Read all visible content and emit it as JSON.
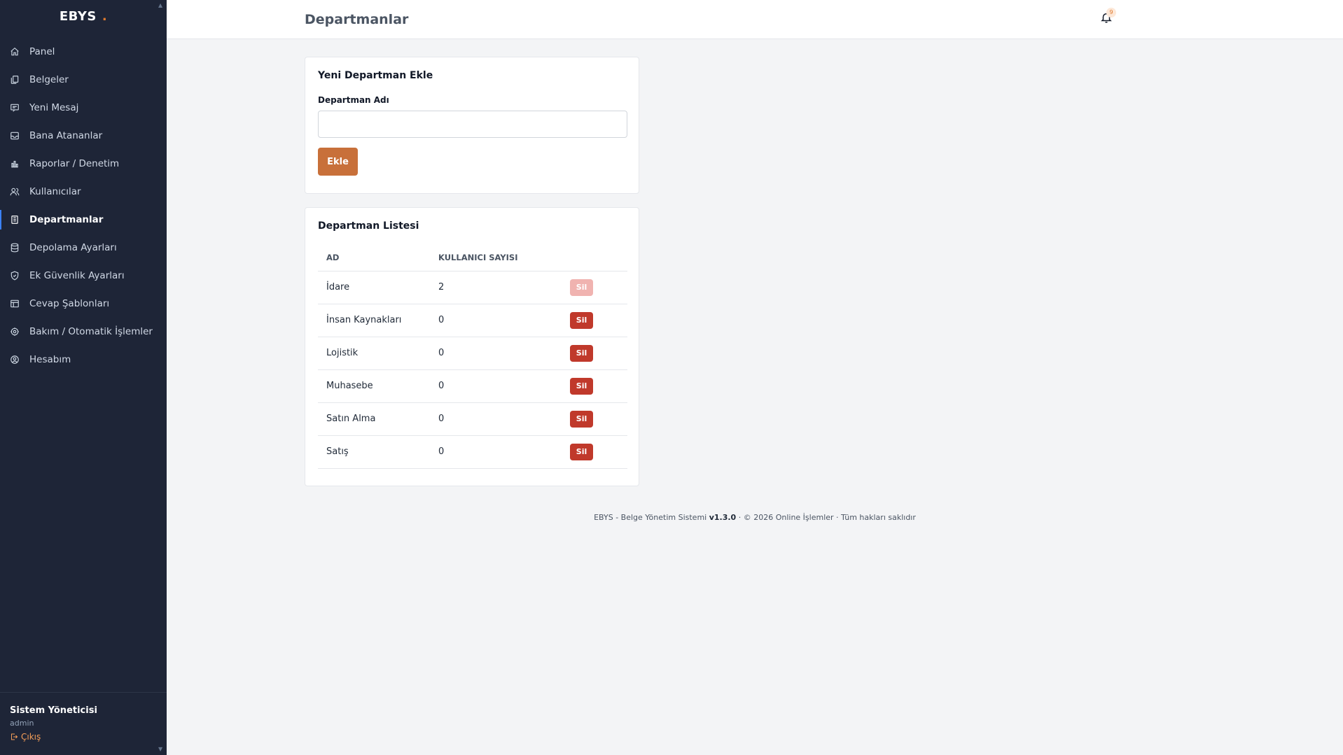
{
  "brand": {
    "name": "EBYS",
    "dot": "."
  },
  "sidebar": {
    "items": [
      {
        "label": "Panel",
        "icon": "home-icon"
      },
      {
        "label": "Belgeler",
        "icon": "documents-icon"
      },
      {
        "label": "Yeni Mesaj",
        "icon": "message-icon"
      },
      {
        "label": "Bana Atananlar",
        "icon": "inbox-icon"
      },
      {
        "label": "Raporlar / Denetim",
        "icon": "bar-chart-icon"
      },
      {
        "label": "Kullanıcılar",
        "icon": "users-icon"
      },
      {
        "label": "Departmanlar",
        "icon": "building-icon",
        "active": true
      },
      {
        "label": "Depolama Ayarları",
        "icon": "database-icon"
      },
      {
        "label": "Ek Güvenlik Ayarları",
        "icon": "shield-icon"
      },
      {
        "label": "Cevap Şablonları",
        "icon": "template-icon"
      },
      {
        "label": "Bakım / Otomatik İşlemler",
        "icon": "gear-icon"
      },
      {
        "label": "Hesabım",
        "icon": "user-circle-icon"
      }
    ],
    "user": {
      "name": "Sistem Yöneticisi",
      "role": "admin",
      "logout_label": "Çıkış"
    }
  },
  "header": {
    "title": "Departmanlar",
    "notification_count": "9"
  },
  "add_card": {
    "title": "Yeni Departman Ekle",
    "field_label": "Departman Adı",
    "input_value": "",
    "button_label": "Ekle"
  },
  "list_card": {
    "title": "Departman Listesi",
    "columns": [
      "AD",
      "KULLANICI SAYISI"
    ],
    "rows": [
      {
        "name": "İdare",
        "count": "2",
        "delete_label": "Sil",
        "disabled": true
      },
      {
        "name": "İnsan Kaynakları",
        "count": "0",
        "delete_label": "Sil",
        "disabled": false
      },
      {
        "name": "Lojistik",
        "count": "0",
        "delete_label": "Sil",
        "disabled": false
      },
      {
        "name": "Muhasebe",
        "count": "0",
        "delete_label": "Sil",
        "disabled": false
      },
      {
        "name": "Satın Alma",
        "count": "0",
        "delete_label": "Sil",
        "disabled": false
      },
      {
        "name": "Satış",
        "count": "0",
        "delete_label": "Sil",
        "disabled": false
      }
    ]
  },
  "footer": {
    "prefix": "EBYS - Belge Yönetim Sistemi ",
    "version": "v1.3.0",
    "suffix": " · © 2026 Online İşlemler · Tüm hakları saklıdır"
  },
  "colors": {
    "sidebar_bg": "#1e2537",
    "accent": "#c8703a",
    "danger": "#c0392b",
    "danger_disabled": "#f0b3b0",
    "active_indicator": "#3b82f6"
  }
}
